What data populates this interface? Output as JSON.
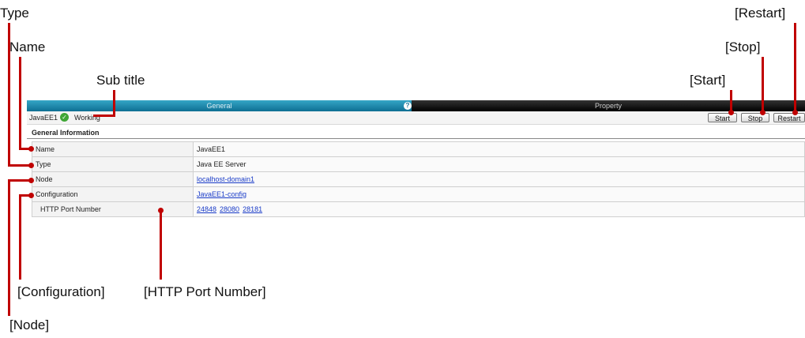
{
  "callouts": {
    "type": "Type",
    "name": "Name",
    "sub_title": "Sub title",
    "start": "[Start]",
    "stop": "[Stop]",
    "restart": "[Restart]",
    "configuration": "[Configuration]",
    "http_port_number": "[HTTP Port Number]",
    "node": "[Node]"
  },
  "tabs": {
    "general": "General",
    "help": "?",
    "property": "Property"
  },
  "subbar": {
    "name": "JavaEE1",
    "status": "Working",
    "status_icon": "check-icon"
  },
  "buttons": {
    "start": "Start",
    "stop": "Stop",
    "restart": "Restart"
  },
  "section_title": "General Information",
  "rows": {
    "name": {
      "label": "Name",
      "value": "JavaEE1"
    },
    "type": {
      "label": "Type",
      "value": "Java EE Server"
    },
    "node": {
      "label": "Node",
      "value": "localhost-domain1"
    },
    "configuration": {
      "label": "Configuration",
      "value": "JavaEE1-config"
    },
    "http": {
      "label": "HTTP Port Number",
      "ports": [
        "24848",
        "28080",
        "28181"
      ]
    }
  },
  "colors": {
    "callout_line": "#c00000",
    "general_tab": "#0e6f93",
    "property_tab": "#000000",
    "link": "#1a3cc8",
    "status_ok": "#3fa635"
  }
}
